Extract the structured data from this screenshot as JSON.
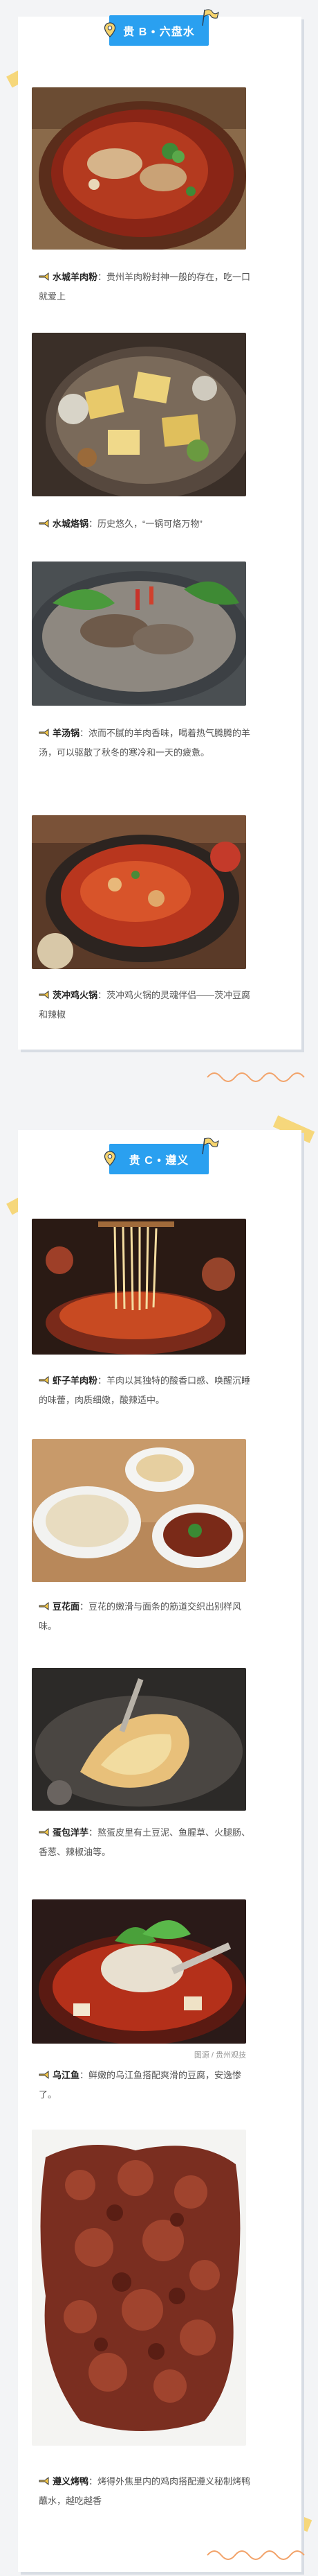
{
  "sections": [
    {
      "badge": "贵 B • 六盘水",
      "items": [
        {
          "name": "水城羊肉粉",
          "text": "：贵州羊肉粉封神一般的存在，吃一口就爱上"
        },
        {
          "name": "水城烙锅",
          "text": "：历史悠久，“一锅可烙万物”"
        },
        {
          "name": "羊汤锅",
          "text": "：浓而不腻的羊肉香味，喝着热气腾腾的羊汤，可以驱散了秋冬的寒冷和一天的疲惫。"
        },
        {
          "name": "茨冲鸡火锅",
          "text": "：茨冲鸡火锅的灵魂伴侣——茨冲豆腐和辣椒"
        }
      ]
    },
    {
      "badge": "贵 C • 遵义",
      "items": [
        {
          "name": "虾子羊肉粉",
          "text": "：羊肉以其独特的酸香口感、唤醒沉睡的味蕾，肉质细嫩，酸辣适中。"
        },
        {
          "name": "豆花面",
          "text": "：豆花的嫩滑与面条的筋道交织出别样风味。"
        },
        {
          "name": "蛋包洋芋",
          "text": "：熬蛋皮里有土豆泥、鱼腥草、火腿肠、香葱、辣椒油等。"
        },
        {
          "name": "乌江鱼",
          "text": "：鲜嫩的乌江鱼搭配爽滑的豆腐，安逸惨了。"
        },
        {
          "name": "遵义烤鸭",
          "text": "：烤得外焦里内的鸡肉搭配遵义秘制烤鸭蘸水，越吃越香"
        }
      ],
      "credit": "图源 / 贵州观技"
    }
  ]
}
